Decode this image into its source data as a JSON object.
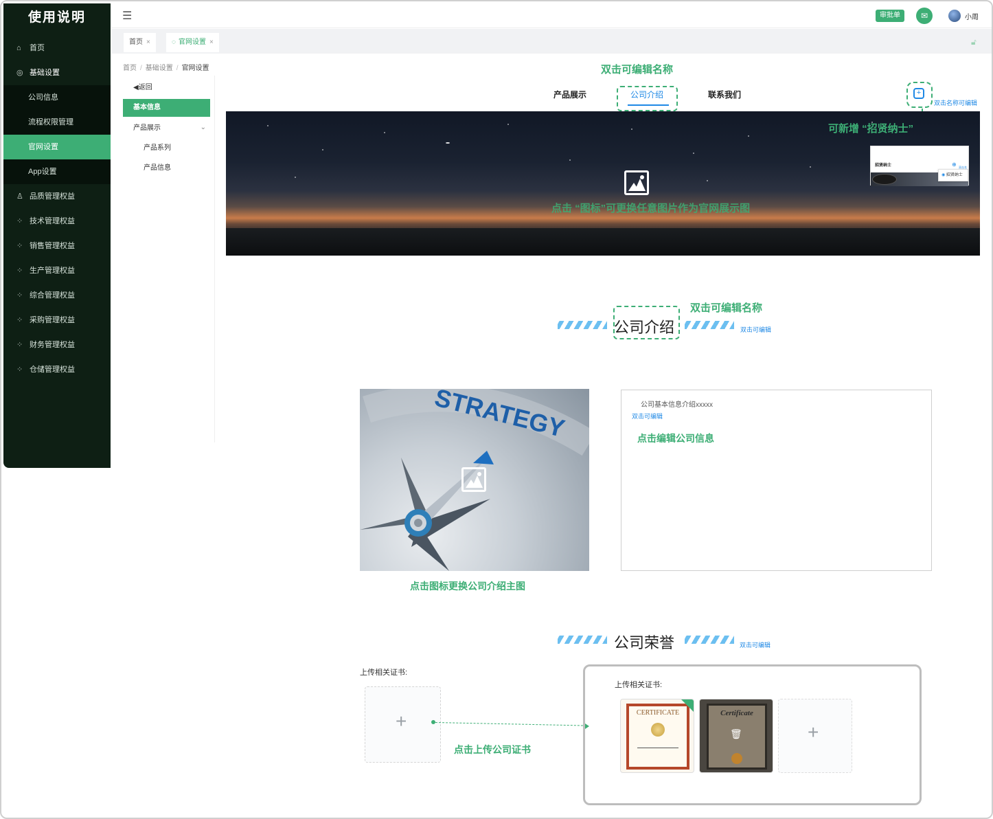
{
  "app": {
    "title": "使用说明"
  },
  "sidebar": {
    "items": [
      {
        "label": "首页",
        "icon": "home-icon"
      },
      {
        "label": "基础设置",
        "icon": "settings-icon"
      },
      {
        "label": "品质管理权益",
        "icon": "user-icon"
      },
      {
        "label": "技术管理权益",
        "icon": "grid-icon"
      },
      {
        "label": "销售管理权益",
        "icon": "grid-icon"
      },
      {
        "label": "生产管理权益",
        "icon": "grid-icon"
      },
      {
        "label": "综合管理权益",
        "icon": "grid-icon"
      },
      {
        "label": "采购管理权益",
        "icon": "grid-icon"
      },
      {
        "label": "财务管理权益",
        "icon": "grid-icon"
      },
      {
        "label": "仓储管理权益",
        "icon": "grid-icon"
      }
    ],
    "sub_items": [
      "公司信息",
      "流程权限管理",
      "官网设置",
      "App设置"
    ],
    "active_sub": "官网设置"
  },
  "topbar": {
    "approve_label": "审批单",
    "user_name": "小周"
  },
  "tabs": [
    {
      "label": "首页"
    },
    {
      "label": "官网设置"
    }
  ],
  "breadcrumb": [
    "首页",
    "基础设置",
    "官网设置"
  ],
  "subnav": {
    "back": "◀返回",
    "items": [
      "基本信息",
      "产品展示",
      "产品系列",
      "产品信息"
    ]
  },
  "site": {
    "nav": [
      "产品展示",
      "公司介绍",
      "联系我们"
    ],
    "annotations": {
      "dblclick_name": "双击可编辑名称",
      "add_recruit": "可新增 “招贤纳士”",
      "replace_banner": "点击 “图标”可更换任意图片作为官网展示图",
      "dblclick_name_2": "双击可编辑名称",
      "replace_intro_image": "点击图标更换公司介绍主图",
      "edit_company_info": "点击编辑公司信息",
      "upload_cert": "点击上传公司证书"
    },
    "hints": {
      "nav_editable": "双击名称可编辑",
      "dbl_editable": "双击可编辑"
    },
    "mini_preview": {
      "title": "招贤纳士",
      "menu_item": "招贤纳士",
      "hint": "双击名称"
    },
    "intro": {
      "title": "公司介绍",
      "text": "公司基本信息介绍xxxxx",
      "editable": "双击可编辑"
    },
    "honors": {
      "title": "公司荣誉",
      "upload_label": "上传相关证书:",
      "upload_label_2": "上传相关证书:",
      "editable": "双击可编辑"
    },
    "intro_image_text": "STRATEGY"
  },
  "colors": {
    "accent": "#3dae75",
    "sidebar_bg": "#0e1f14",
    "link_blue": "#1e88e5"
  }
}
